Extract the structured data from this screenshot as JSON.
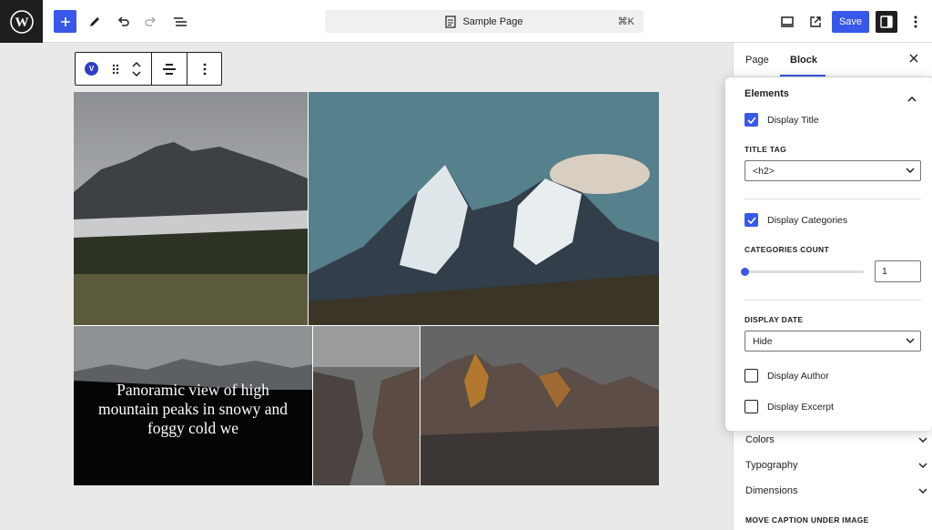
{
  "topbar": {
    "document_title": "Sample Page",
    "shortcut": "⌘K",
    "save_label": "Save"
  },
  "block_toolbar": {
    "block_badge": "V"
  },
  "gallery": {
    "caption": "Panoramic view of high mountain peaks in snowy and foggy cold we"
  },
  "sidebar": {
    "tabs": [
      {
        "label": "Page"
      },
      {
        "label": "Block"
      }
    ],
    "elements_panel": {
      "title": "Elements",
      "display_title": {
        "label": "Display Title",
        "checked": true
      },
      "title_tag": {
        "label": "TITLE TAG",
        "value": "<h2>"
      },
      "display_categories": {
        "label": "Display Categories",
        "checked": true
      },
      "categories_count": {
        "label": "CATEGORIES COUNT",
        "value": "1"
      },
      "display_date": {
        "label": "DISPLAY DATE",
        "value": "Hide"
      },
      "display_author": {
        "label": "Display Author",
        "checked": false
      },
      "display_excerpt": {
        "label": "Display Excerpt",
        "checked": false
      }
    },
    "sections": [
      {
        "label": "Colors"
      },
      {
        "label": "Typography"
      },
      {
        "label": "Dimensions"
      }
    ],
    "move_caption_label": "MOVE CAPTION UNDER IMAGE"
  },
  "colors": {
    "accent": "#3858e9",
    "dark": "#1e1e1e"
  }
}
